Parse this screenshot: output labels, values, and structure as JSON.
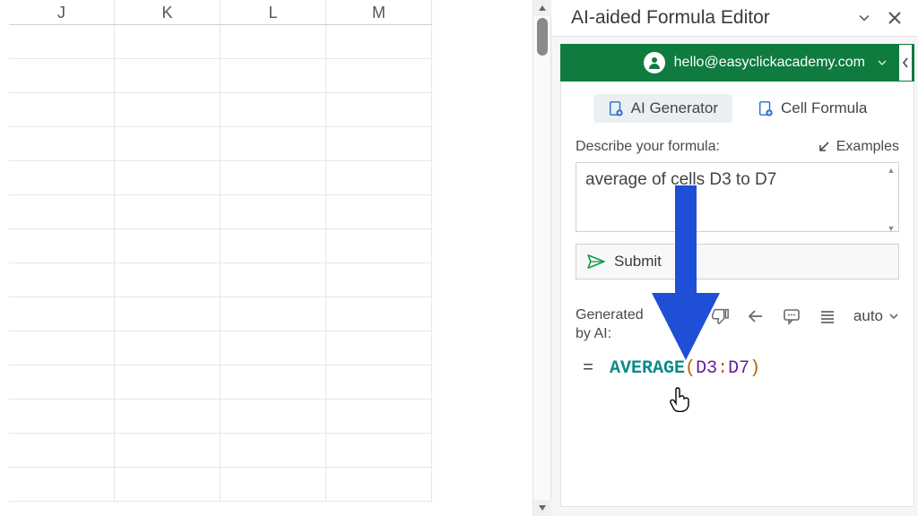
{
  "spreadsheet": {
    "columns": [
      "J",
      "K",
      "L",
      "M"
    ]
  },
  "pane": {
    "title": "AI-aided Formula Editor",
    "account": {
      "email": "hello@easyclickacademy.com"
    },
    "tabs": {
      "ai_generator": "AI Generator",
      "cell_formula": "Cell Formula"
    },
    "describe": {
      "label": "Describe your formula:",
      "examples_label": "Examples",
      "value": "average of cells D3 to D7",
      "submit_label": "Submit"
    },
    "generated": {
      "label": "Generated by AI:",
      "auto_label": "auto",
      "formula": {
        "fn": "AVERAGE",
        "ref1": "D3",
        "ref2": "D7"
      }
    }
  },
  "icons": {
    "collapse": "chevron-down",
    "close": "x",
    "avatar": "person",
    "tab": "add-page",
    "examples": "arrow-lower-left",
    "send": "paper-plane",
    "thumb_up": "thumb-up",
    "thumb_down": "thumb-down",
    "back": "arrow-left",
    "comment": "speech-bubble",
    "lines": "justify",
    "dropdown": "chevron-down"
  },
  "colors": {
    "brand_green": "#0f7b3f",
    "action_green": "#169a46",
    "formula_fn": "#0a8a8a",
    "formula_ref": "#6a1b9a",
    "formula_par": "#b86000",
    "arrow_blue": "#1f4fd6"
  }
}
